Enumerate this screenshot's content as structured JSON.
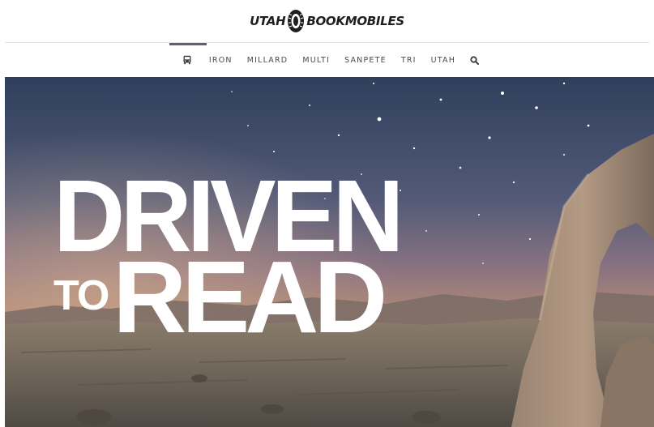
{
  "brand": {
    "logo_left": "UTAH",
    "logo_right": "BOOKMOBILES"
  },
  "nav": {
    "items": [
      {
        "label": "IRON"
      },
      {
        "label": "MILLARD"
      },
      {
        "label": "MULTI"
      },
      {
        "label": "SANPETE"
      },
      {
        "label": "TRI"
      },
      {
        "label": "UTAH"
      }
    ],
    "home_icon": "bus-icon",
    "search_icon": "search-icon",
    "accent_color": "#6b5a7a"
  },
  "hero": {
    "line1": "DRIVEN",
    "line2_small": "TO",
    "line2_large": "READ",
    "background": "desert arches night sky"
  }
}
